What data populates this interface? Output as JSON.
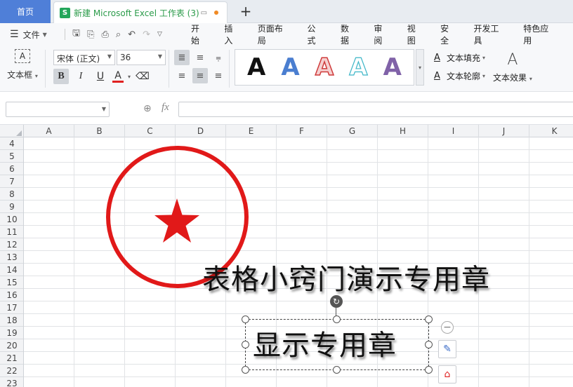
{
  "tabs": {
    "home_label": "首页",
    "doc_title": "新建 Microsoft Excel 工作表 (3)",
    "doc_icon_letter": "S",
    "add_symbol": "+"
  },
  "menu": {
    "file_label": "文件",
    "items": [
      "开始",
      "插入",
      "页面布局",
      "公式",
      "数据",
      "审阅",
      "视图",
      "安全",
      "开发工具",
      "特色应用"
    ]
  },
  "ribbon": {
    "textbox_label": "文本框",
    "font_name": "宋体 (正文)",
    "font_size": "36",
    "bold": "B",
    "italic": "I",
    "underline": "U",
    "font_color_letter": "A",
    "wordart_styles": [
      "A",
      "A",
      "A",
      "A",
      "A"
    ],
    "text_fill_label": "文本填充",
    "text_outline_label": "文本轮廓",
    "text_effect_label": "文本效果",
    "effect_icon_letter": "A",
    "accent_red": "#e02020"
  },
  "formula_bar": {
    "name_box_value": "",
    "fx_label": "fx",
    "formula_value": ""
  },
  "grid": {
    "columns": [
      "A",
      "B",
      "C",
      "D",
      "E",
      "F",
      "G",
      "H",
      "I",
      "J",
      "K"
    ],
    "rows": [
      "4",
      "5",
      "6",
      "7",
      "8",
      "9",
      "10",
      "11",
      "12",
      "13",
      "14",
      "15",
      "16",
      "17",
      "18",
      "19",
      "20",
      "21",
      "22",
      "23"
    ]
  },
  "canvas": {
    "stamp_color": "#e11919",
    "title_text": "表格小窍门演示专用章",
    "selected_text": "显示专用章"
  }
}
